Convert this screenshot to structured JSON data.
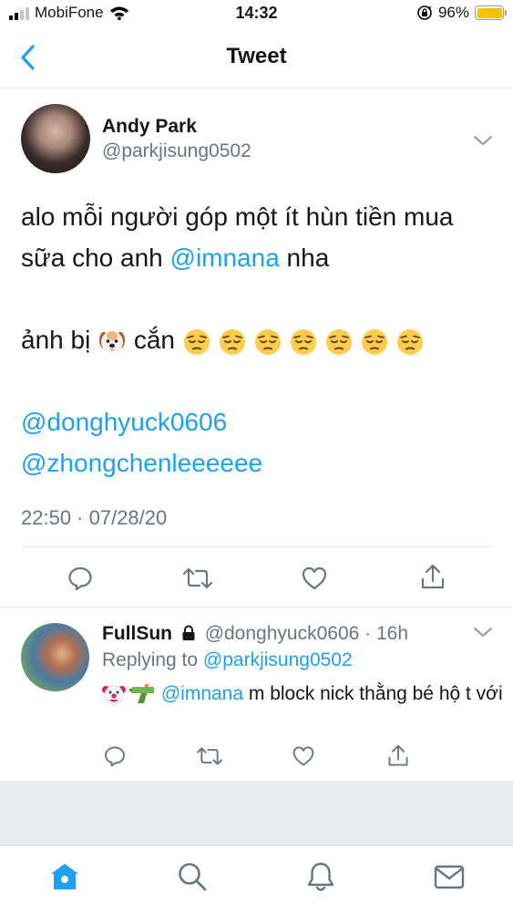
{
  "status_bar": {
    "carrier": "MobiFone",
    "time": "14:32",
    "battery": "96%"
  },
  "nav": {
    "title": "Tweet"
  },
  "tweet": {
    "author_name": "Andy Park",
    "author_handle": "@parkjisung0502",
    "text_line1": "alo mỗi người góp một ít hùn tiền mua",
    "text_line2_prefix": "sữa cho anh ",
    "text_line2_mention": "@imnana",
    "text_line2_suffix": " nha",
    "text_line3_prefix": "ảnh bị ",
    "text_line3_mid": " cắn ",
    "mention_1": "@donghyuck0606",
    "mention_2": "@zhongchenleeeeee",
    "timestamp": "22:50 · 07/28/20",
    "emojis": [
      "dog-face-emoji",
      "pensive-face-emoji"
    ]
  },
  "reply": {
    "author_name": "FullSun",
    "author_handle": "@donghyuck0606",
    "age": " · 16h",
    "replying_label": "Replying to ",
    "replying_handle": "@parkjisung0502",
    "mention": "@imnana",
    "text": " m block nick thằng bé hộ t với",
    "emojis": [
      "clown-face-emoji",
      "water-pistol-emoji"
    ]
  },
  "tabs": [
    {
      "name": "home-icon",
      "active": true
    },
    {
      "name": "search-icon",
      "active": false
    },
    {
      "name": "bell-icon",
      "active": false
    },
    {
      "name": "mail-icon",
      "active": false
    }
  ],
  "colors": {
    "accent": "#1da1f2",
    "secondary_text": "#657786",
    "icon_gray": "#657786",
    "divider": "#e1e8ed",
    "battery": "#f5c400"
  }
}
